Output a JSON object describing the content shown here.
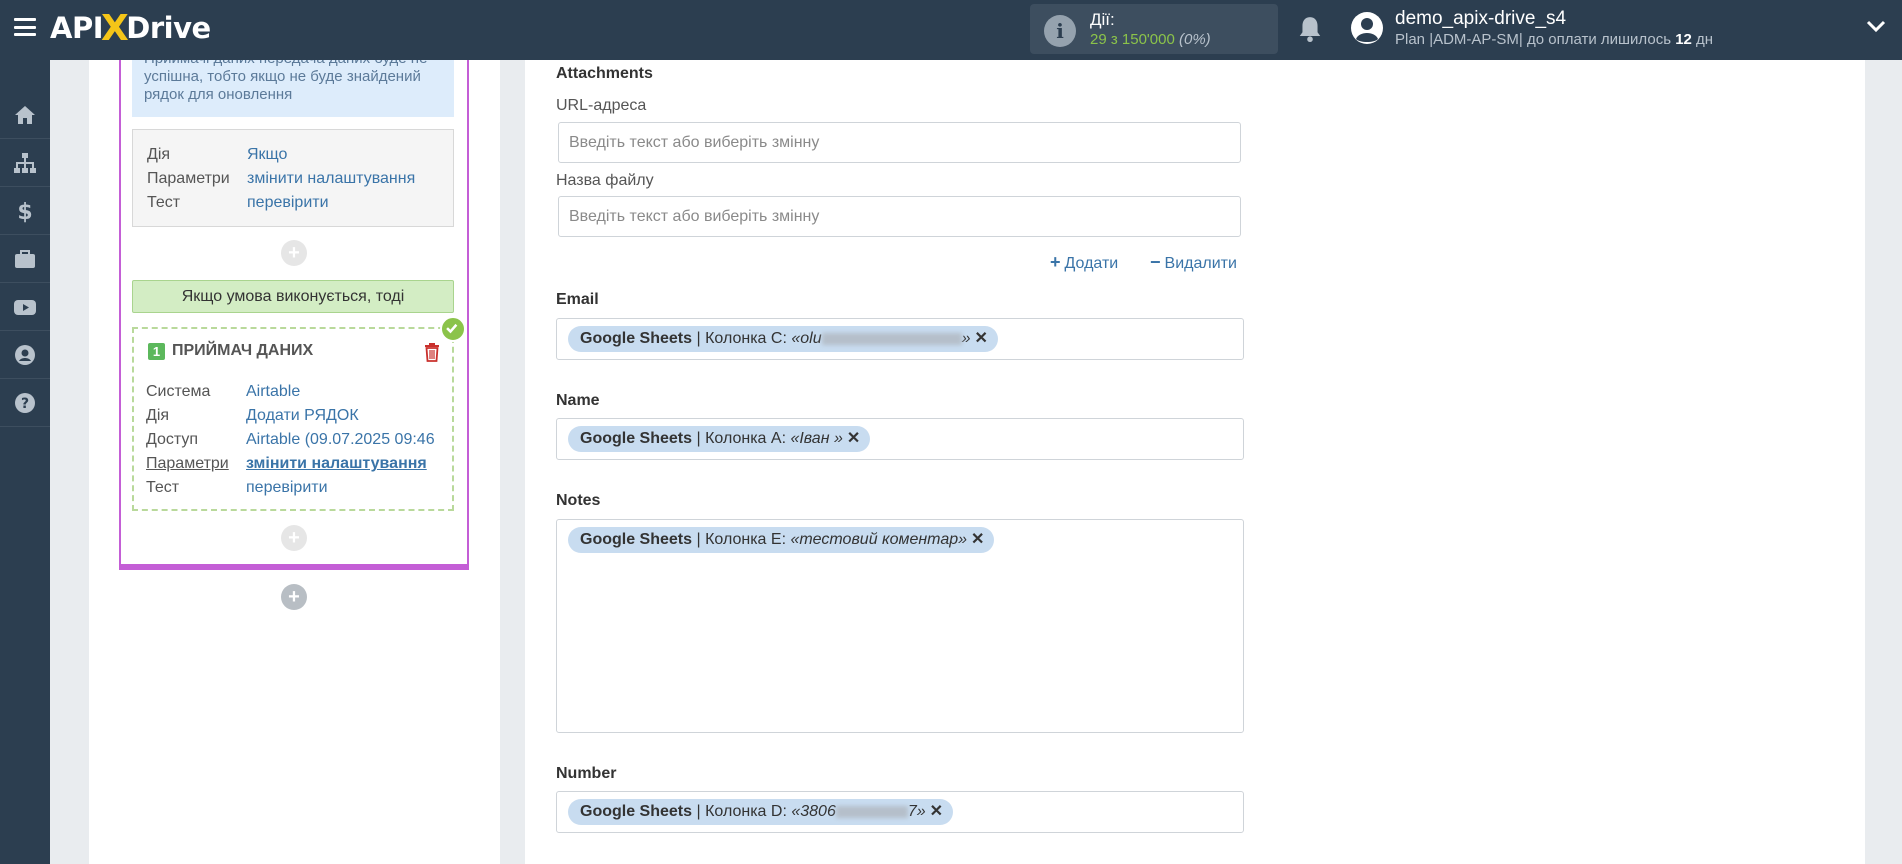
{
  "header": {
    "logo_prefix": "API",
    "logo_x": "X",
    "logo_suffix": "Drive",
    "actions_label": "Дії:",
    "actions_value": "29 з 150'000",
    "actions_percent": "(0%)",
    "username": "demo_apix-drive_s4",
    "plan_text": "Plan |ADM-AP-SM| до оплати лишилось",
    "plan_days": "12",
    "plan_days_unit": "дн"
  },
  "sidebar": {
    "icons": [
      "home-icon",
      "sitemap-icon",
      "dollar-icon",
      "briefcase-icon",
      "youtube-icon",
      "user-icon",
      "help-icon"
    ]
  },
  "left_panel": {
    "note_text": "Приймачі даних передача даних буде не успішна, тобто якщо не буде знайдений рядок для оновлення",
    "condition": {
      "action_key": "Дія",
      "action_value": "Якщо",
      "params_key": "Параметри",
      "params_value": "змінити налаштування",
      "test_key": "Тест",
      "test_value": "перевірити"
    },
    "green_bar": "Якщо умова виконується, тоді",
    "receiver": {
      "number": "1",
      "title": "ПРИЙМАЧ ДАНИХ",
      "system_key": "Система",
      "system_value": "Airtable",
      "action_key": "Дія",
      "action_value": "Додати РЯДОК",
      "access_key": "Доступ",
      "access_value": "Airtable (09.07.2025 09:46",
      "params_key": "Параметри",
      "params_value": "змінити налаштування",
      "test_key": "Тест",
      "test_value": "перевірити"
    },
    "plus": "+"
  },
  "main": {
    "attachments_label": "Attachments",
    "url_label": "URL-адреса",
    "url_placeholder": "Введіть текст або виберіть змінну",
    "filename_label": "Назва файлу",
    "filename_placeholder": "Введіть текст або виберіть змінну",
    "add_label": "Додати",
    "remove_label": "Видалити",
    "fields": [
      {
        "label": "Email",
        "source": "Google Sheets",
        "column": " | Колонка C: ",
        "value_prefix": "«olu",
        "value_suffix": "»"
      },
      {
        "label": "Name",
        "source": "Google Sheets",
        "column": " | Колонка A: ",
        "value_prefix": "«Іван »",
        "value_suffix": ""
      },
      {
        "label": "Notes",
        "source": "Google Sheets",
        "column": " | Колонка E: ",
        "value_prefix": "«тестовий коментар»",
        "value_suffix": ""
      },
      {
        "label": "Number",
        "source": "Google Sheets",
        "column": " | Колонка D: ",
        "value_prefix": "«3806",
        "value_suffix": "7»"
      }
    ],
    "tag_remove": "✕"
  },
  "colors": {
    "header_bg": "#2c3e50",
    "accent_green": "#8bc34a",
    "pipeline_border": "#c45ed6",
    "link_blue": "#3a74a8",
    "tag_bg": "#c8dcf0"
  }
}
